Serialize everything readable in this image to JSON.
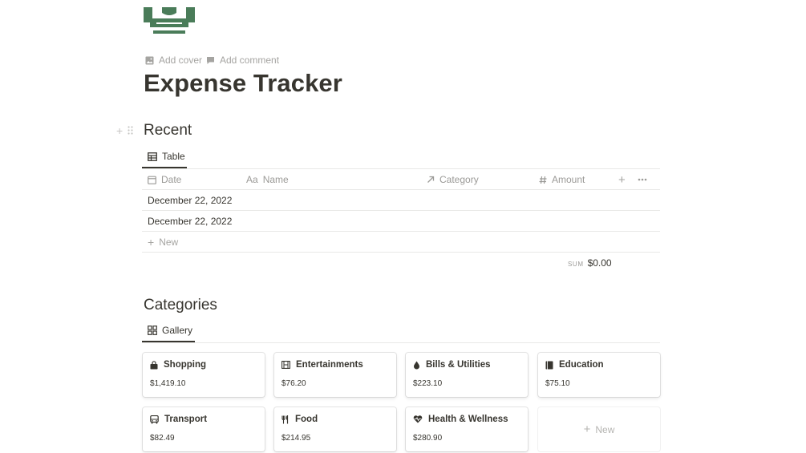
{
  "page": {
    "icon": "money-stack-icon",
    "add_cover": "Add cover",
    "add_comment": "Add comment",
    "title": "Expense Tracker",
    "accent_color": "#4a7c59"
  },
  "recent": {
    "heading": "Recent",
    "view_tab": "Table",
    "columns": [
      {
        "label": "Date",
        "icon": "calendar-icon"
      },
      {
        "label": "Name",
        "icon": "text-property-icon",
        "prefix": "Aa"
      },
      {
        "label": "Category",
        "icon": "relation-arrow-icon"
      },
      {
        "label": "Amount",
        "icon": "number-hash-icon"
      }
    ],
    "rows": [
      {
        "date": "December 22, 2022",
        "name": "",
        "category": "",
        "amount": ""
      },
      {
        "date": "December 22, 2022",
        "name": "",
        "category": "",
        "amount": ""
      }
    ],
    "new_row": "New",
    "sum_label": "SUM",
    "sum_value": "$0.00"
  },
  "categories": {
    "heading": "Categories",
    "view_tab": "Gallery",
    "cards": [
      {
        "title": "Shopping",
        "value": "$1,419.10",
        "icon": "shopping-bag-icon"
      },
      {
        "title": "Entertainments",
        "value": "$76.20",
        "icon": "film-icon"
      },
      {
        "title": "Bills & Utilities",
        "value": "$223.10",
        "icon": "water-drop-icon"
      },
      {
        "title": "Education",
        "value": "$75.10",
        "icon": "book-icon"
      },
      {
        "title": "Transport",
        "value": "$82.49",
        "icon": "bus-icon"
      },
      {
        "title": "Food",
        "value": "$214.95",
        "icon": "fork-knife-icon"
      },
      {
        "title": "Health & Wellness",
        "value": "$280.90",
        "icon": "heart-pulse-icon"
      }
    ],
    "new_card": "New"
  }
}
